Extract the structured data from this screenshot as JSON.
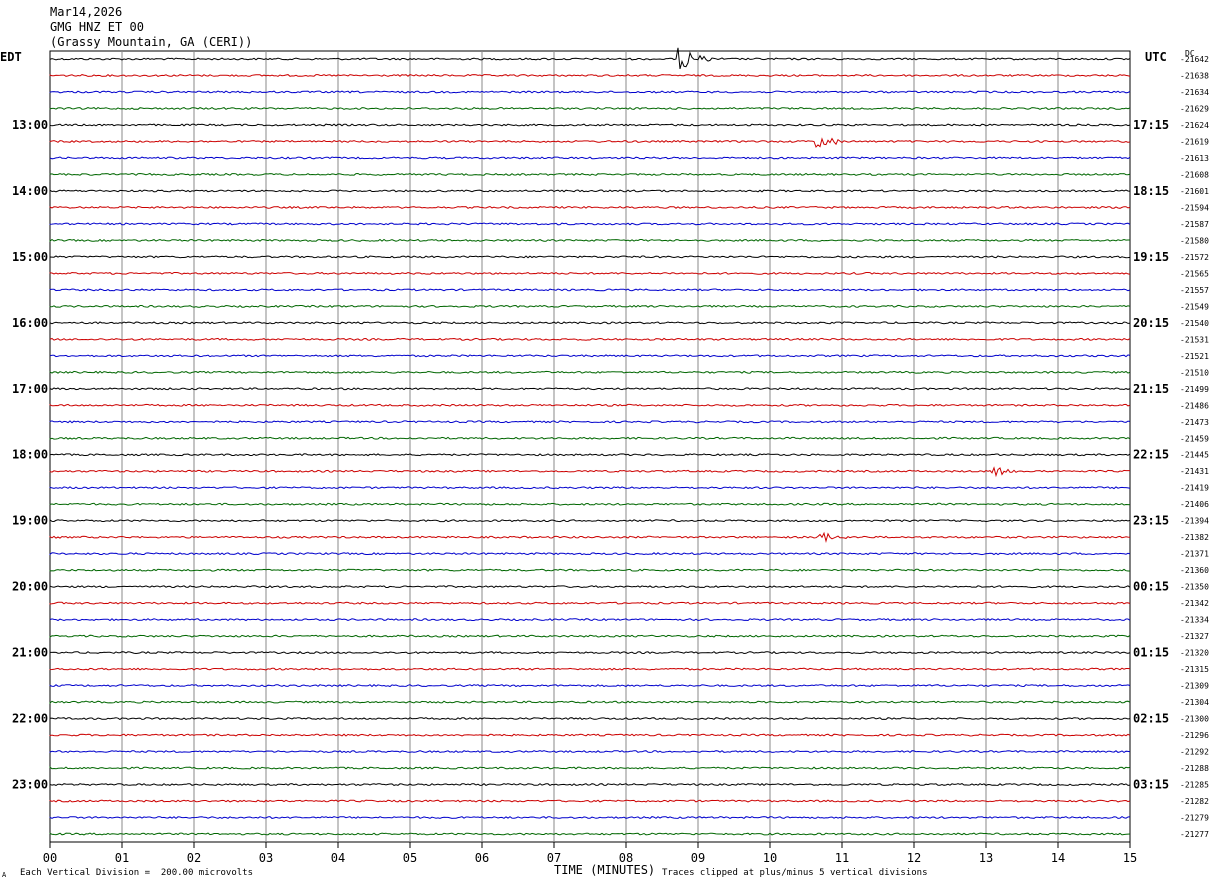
{
  "header": {
    "date": "Mar14,2026",
    "station": "GMG HNZ ET 00",
    "location": "(Grassy Mountain, GA (CERI))"
  },
  "left_tz": "EDT",
  "right_tz": "UTC",
  "dc_label": "DC",
  "footer": {
    "scale_note": "Each Vertical Division =  200.00 microvolts",
    "clip_note": "Traces clipped at plus/minus 5 vertical divisions",
    "corner_mark": "A"
  },
  "chart_data": {
    "type": "line",
    "title": "GMG HNZ ET 00 (Grassy Mountain, GA (CERI))",
    "xlabel": "TIME (MINUTES)",
    "x_ticks": [
      "00",
      "01",
      "02",
      "03",
      "04",
      "05",
      "06",
      "07",
      "08",
      "09",
      "10",
      "11",
      "12",
      "13",
      "14",
      "15"
    ],
    "xlim": [
      0,
      15
    ],
    "trace_colors": [
      "#000000",
      "#cc0000",
      "#0000cc",
      "#006600"
    ],
    "left_hour_labels": [
      "13:00",
      "14:00",
      "15:00",
      "16:00",
      "17:00",
      "18:00",
      "19:00",
      "20:00",
      "21:00",
      "22:00",
      "23:00"
    ],
    "right_hour_labels": [
      "17:15",
      "18:15",
      "19:15",
      "20:15",
      "21:15",
      "22:15",
      "23:15",
      "00:15",
      "01:15",
      "02:15",
      "03:15"
    ],
    "dc_offsets": [
      "-21642",
      "-21638",
      "-21634",
      "-21629",
      "-21624",
      "-21619",
      "-21613",
      "-21608",
      "-21601",
      "-21594",
      "-21587",
      "-21580",
      "-21572",
      "-21565",
      "-21557",
      "-21549",
      "-21540",
      "-21531",
      "-21521",
      "-21510",
      "-21499",
      "-21486",
      "-21473",
      "-21459",
      "-21445",
      "-21431",
      "-21419",
      "-21406",
      "-21394",
      "-21382",
      "-21371",
      "-21360",
      "-21350",
      "-21342",
      "-21334",
      "-21327",
      "-21320",
      "-21315",
      "-21309",
      "-21304",
      "-21300",
      "-21296",
      "-21292",
      "-21288",
      "-21285",
      "-21282",
      "-21279",
      "-21277"
    ],
    "events": [
      {
        "trace": 0,
        "minute": 8.85,
        "amplitude": "large"
      },
      {
        "trace": 5,
        "minute": 10.75,
        "amplitude": "small"
      },
      {
        "trace": 25,
        "minute": 13.15,
        "amplitude": "small"
      },
      {
        "trace": 29,
        "minute": 10.8,
        "amplitude": "medium"
      }
    ]
  }
}
